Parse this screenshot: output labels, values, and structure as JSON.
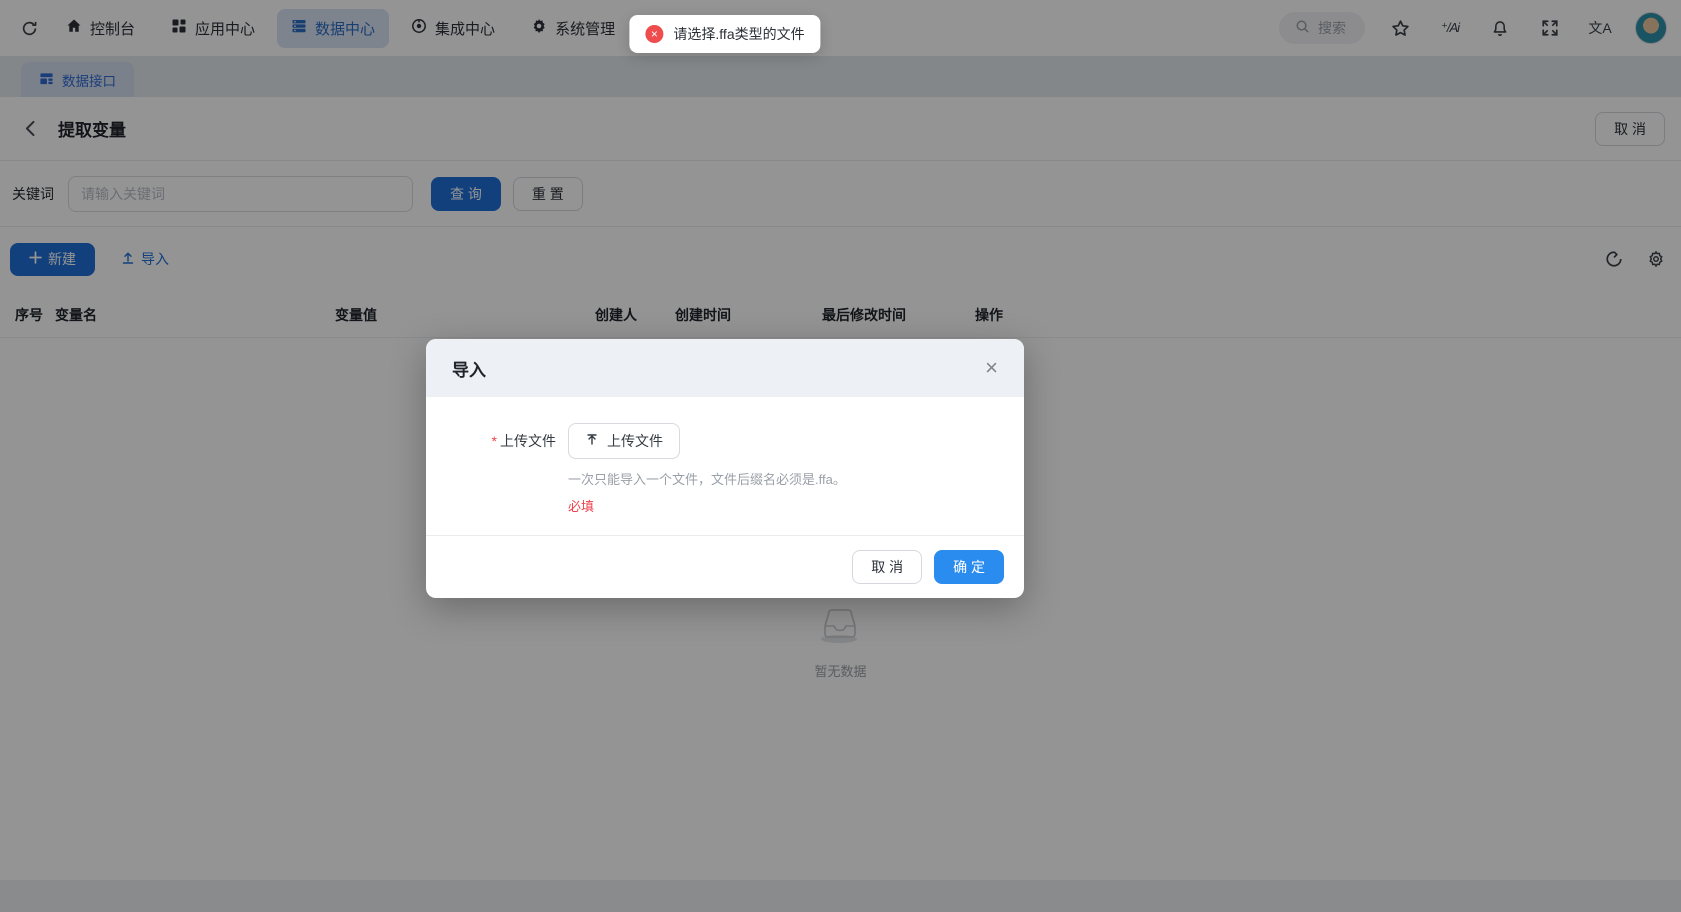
{
  "nav": {
    "items": [
      {
        "label": "控制台",
        "icon": "home-icon"
      },
      {
        "label": "应用中心",
        "icon": "apps-icon"
      },
      {
        "label": "数据中心",
        "icon": "database-icon",
        "active": true
      },
      {
        "label": "集成中心",
        "icon": "integration-icon"
      },
      {
        "label": "系统管理",
        "icon": "gear-icon"
      }
    ],
    "search_placeholder": "搜索",
    "ai_glyph": "⁺/Ai",
    "translate_glyph": "文A"
  },
  "toast": {
    "message": "请选择.ffa类型的文件"
  },
  "tab": {
    "label": "数据接口"
  },
  "page": {
    "title": "提取变量",
    "cancel_label": "取 消"
  },
  "filter": {
    "keyword_label": "关键词",
    "keyword_placeholder": "请输入关键词",
    "query_label": "查 询",
    "reset_label": "重 置"
  },
  "toolbar": {
    "new_label": "新建",
    "import_label": "导入"
  },
  "table": {
    "columns": [
      "序号",
      "变量名",
      "变量值",
      "创建人",
      "创建时间",
      "最后修改时间",
      "操作"
    ],
    "empty_text": "暂无数据"
  },
  "modal": {
    "title": "导入",
    "field_label": "上传文件",
    "required_mark": "*",
    "upload_button": "上传文件",
    "hint": "一次只能导入一个文件，文件后缀名必须是.ffa。",
    "error": "必填",
    "cancel_label": "取 消",
    "confirm_label": "确 定",
    "close_glyph": "×"
  },
  "colors": {
    "primary": "#1f6fd6",
    "confirm_blue": "#2b8cf0",
    "danger": "#ef4d4d"
  }
}
